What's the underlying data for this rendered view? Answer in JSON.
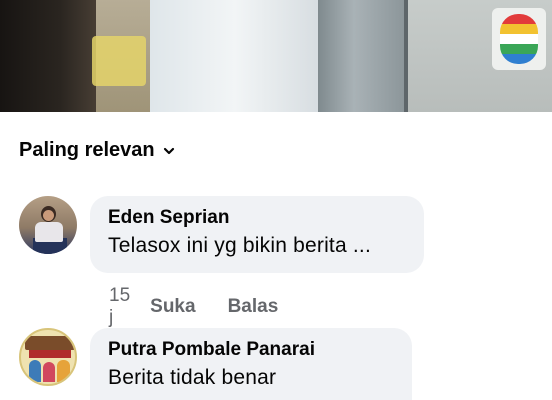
{
  "sort": {
    "label": "Paling relevan"
  },
  "comments": [
    {
      "author": "Eden Seprian",
      "text": "Telasox ini yg bikin berita ...",
      "time": "15 j",
      "like_label": "Suka",
      "reply_label": "Balas"
    },
    {
      "author": "Putra Pombale Panarai",
      "text": "Berita tidak benar"
    }
  ],
  "colors": {
    "bubble": "#f0f2f5",
    "meta_text": "#65676b",
    "primary_text": "#050505"
  },
  "icons": {
    "sort_chevron": "chevron-down-icon",
    "channel_logo": "tv-channel-logo-icon"
  }
}
